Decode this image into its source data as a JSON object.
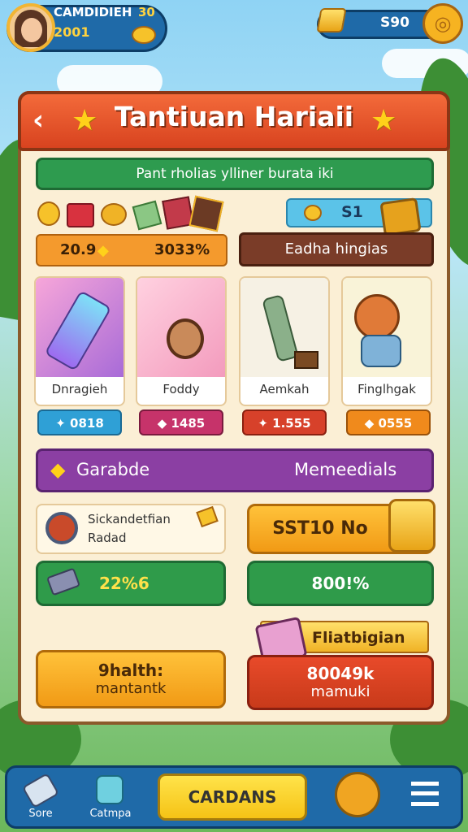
{
  "player": {
    "name": "CAMDIDIEH",
    "level_icon": "3",
    "score": "2001",
    "level_badge": "30"
  },
  "currency": {
    "gold": "S90",
    "add_icon": "coin-icon"
  },
  "panel": {
    "title": "Tantiuan Hariaii",
    "subtitle": "Pant rholias ylliner burata iki",
    "reward_left_a": "20.9",
    "reward_left_b": "3033%",
    "reward_right_val": "S1",
    "section_button": "Eadha hingias",
    "cards": [
      {
        "label": "Dnragieh",
        "value": "0818",
        "color": "#2fa0d6"
      },
      {
        "label": "Foddy",
        "value": "1485",
        "color": "#c6336a"
      },
      {
        "label": "Aemkah",
        "value": "1.555",
        "color": "#d7412a"
      },
      {
        "label": "Finglhgak",
        "value": "0555",
        "color": "#f08a1c"
      }
    ],
    "purple_left": "Garabde",
    "purple_right": "Memeedials",
    "info_title": "Sickandetfian",
    "info_sub": "Radad",
    "price_btn": "SST10 No",
    "progress_left": "22%6",
    "progress_right": "800!%",
    "ribbon": "Fliatbigian",
    "bottom_left_a": "9halth:",
    "bottom_left_b": "mantantk",
    "bottom_right_a": "80049k",
    "bottom_right_b": "mamuki"
  },
  "nav": {
    "left1": "Sore",
    "left2": "Catmpa",
    "center": "CARDANS"
  }
}
